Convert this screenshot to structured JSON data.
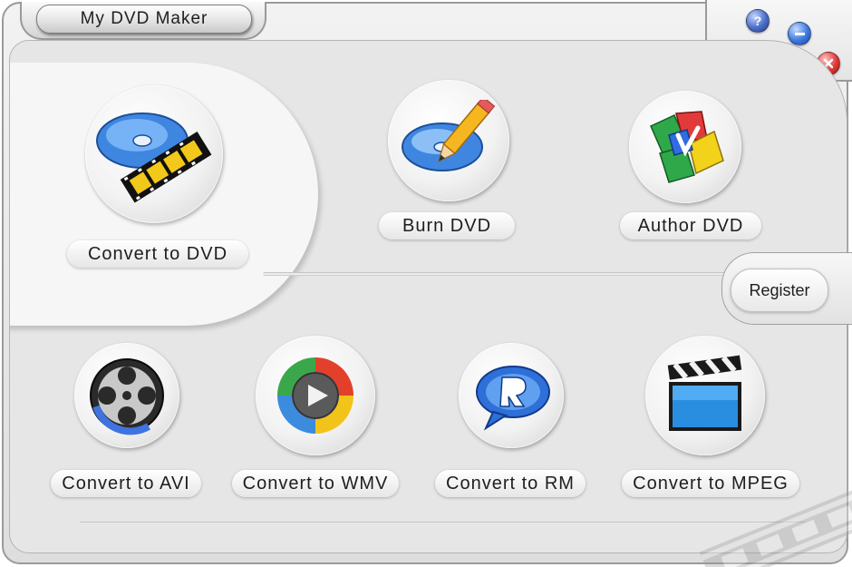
{
  "window": {
    "title": "My DVD Maker"
  },
  "controls": {
    "help_label": "?"
  },
  "register": {
    "label": "Register"
  },
  "actions": [
    {
      "label": "Convert to DVD",
      "icon": "dvd-film-icon"
    },
    {
      "label": "Burn DVD",
      "icon": "disc-pencil-icon"
    },
    {
      "label": "Author DVD",
      "icon": "author-blocks-icon"
    },
    {
      "label": "Convert to AVI",
      "icon": "film-reel-icon"
    },
    {
      "label": "Convert to WMV",
      "icon": "media-player-icon"
    },
    {
      "label": "Convert to RM",
      "icon": "realplayer-icon"
    },
    {
      "label": "Convert to MPEG",
      "icon": "clapperboard-icon"
    }
  ],
  "colors": {
    "disc_blue": "#3f86e0",
    "film_yellow": "#f2c81a",
    "close_red": "#e03a3a",
    "minimize_blue": "#3d78e0"
  }
}
